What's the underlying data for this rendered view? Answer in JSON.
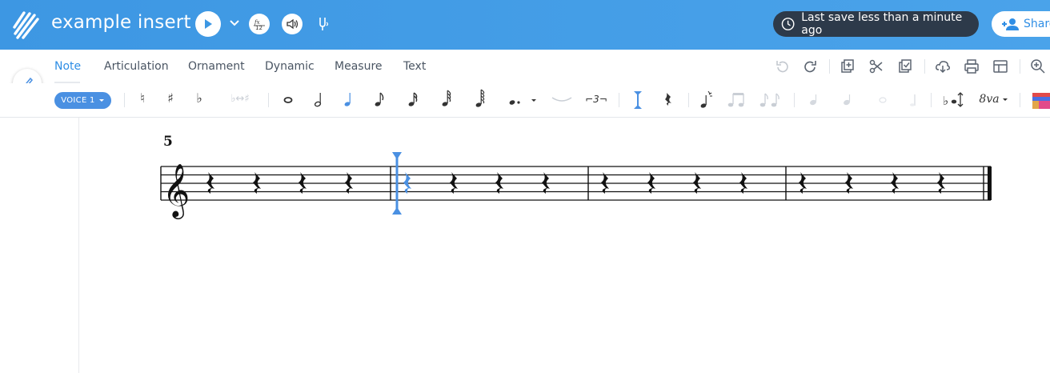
{
  "header": {
    "title": "example insert",
    "save_status": "Last save less than a minute ago",
    "share_label": "Share"
  },
  "tabs": [
    {
      "label": "Note",
      "active": true
    },
    {
      "label": "Articulation",
      "active": false
    },
    {
      "label": "Ornament",
      "active": false
    },
    {
      "label": "Dynamic",
      "active": false
    },
    {
      "label": "Measure",
      "active": false
    },
    {
      "label": "Text",
      "active": false
    }
  ],
  "toolbar": {
    "voice_label": "VOICE 1",
    "natural": "♮",
    "sharp": "♯",
    "flat": "♭",
    "enharmonic": "♭↔♯",
    "tuplet": "⌐3¬",
    "ottava": "8va"
  },
  "score": {
    "measure_number": "5",
    "clef": "treble",
    "measures": 4,
    "rests_per_measure": 4,
    "cursor_measure": 2
  },
  "colors": {
    "header_blue": "#4aa3ea",
    "accent": "#2f8ee5",
    "cursor": "#4a90e2",
    "save_badge": "#2d3a4a"
  }
}
